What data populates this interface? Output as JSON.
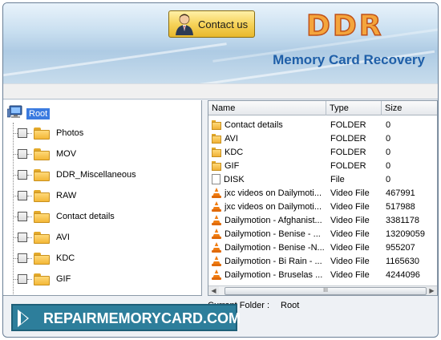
{
  "header": {
    "contact_label": "Contact us",
    "logo_text": "DDR",
    "product_title": "Memory Card Recovery"
  },
  "tree": {
    "root_label": "Root",
    "items": [
      {
        "label": "Photos"
      },
      {
        "label": "MOV"
      },
      {
        "label": "DDR_Miscellaneous"
      },
      {
        "label": "RAW"
      },
      {
        "label": "Contact details"
      },
      {
        "label": "AVI"
      },
      {
        "label": "KDC"
      },
      {
        "label": "GIF"
      }
    ]
  },
  "list": {
    "columns": {
      "name": "Name",
      "type": "Type",
      "size": "Size"
    },
    "rows": [
      {
        "icon": "folder-icon",
        "name": "Contact details",
        "type": "FOLDER",
        "size": "0"
      },
      {
        "icon": "folder-icon",
        "name": "AVI",
        "type": "FOLDER",
        "size": "0"
      },
      {
        "icon": "folder-icon",
        "name": "KDC",
        "type": "FOLDER",
        "size": "0"
      },
      {
        "icon": "folder-icon",
        "name": "GIF",
        "type": "FOLDER",
        "size": "0"
      },
      {
        "icon": "file-icon",
        "name": "DISK",
        "type": "File",
        "size": "0"
      },
      {
        "icon": "vlc-icon",
        "name": "jxc videos on Dailymoti...",
        "type": "Video File",
        "size": "467991"
      },
      {
        "icon": "vlc-icon",
        "name": "jxc videos on Dailymoti...",
        "type": "Video File",
        "size": "517988"
      },
      {
        "icon": "vlc-icon",
        "name": "Dailymotion - Afghanist...",
        "type": "Video File",
        "size": "3381178"
      },
      {
        "icon": "vlc-icon",
        "name": "Dailymotion - Benise - ...",
        "type": "Video File",
        "size": "13209059"
      },
      {
        "icon": "vlc-icon",
        "name": "Dailymotion - Benise -N...",
        "type": "Video File",
        "size": "955207"
      },
      {
        "icon": "vlc-icon",
        "name": "Dailymotion - Bi Rain - ...",
        "type": "Video File",
        "size": "1165630"
      },
      {
        "icon": "vlc-icon",
        "name": "Dailymotion - Bruselas ...",
        "type": "Video File",
        "size": "4244096"
      }
    ],
    "scroll_thumb_glyph": "III"
  },
  "status": {
    "label": "Current Folder :",
    "value": "Root"
  },
  "banner": {
    "text": "REPAIRMEMORYCARD.COM"
  }
}
